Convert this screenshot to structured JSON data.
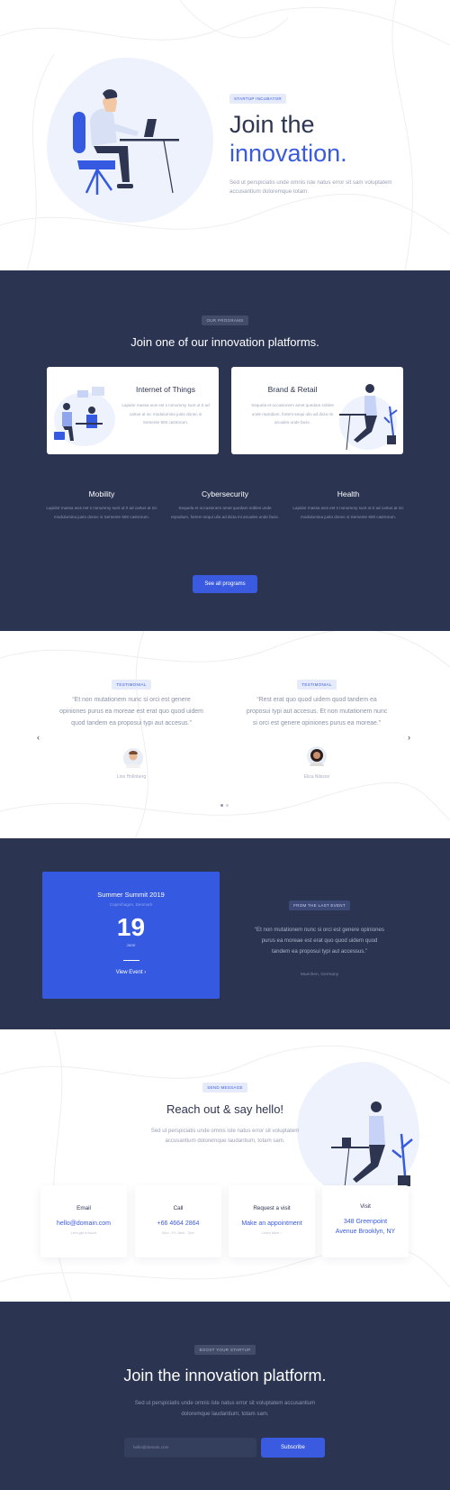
{
  "hero": {
    "badge": "STARTUP INCUBATOR",
    "title_line1": "Join the",
    "title_line2": "innovation.",
    "description": "Sed ut perspiciatis unde omnis iste natus error sit sam voluptatem accusantium doloremque totam."
  },
  "programs": {
    "badge": "OUR PROGRAMS",
    "title": "Join one of our innovation platforms.",
    "cards": [
      {
        "title": "Internet of Things",
        "desc": "Lapidor massa wos est s nonummy sunt ut 0 ad cartus at nic modulumina justo donec si Semente 600 castrorum."
      },
      {
        "title": "Brand & Retail",
        "desc": "Sequela et occasionem amet quedam sobles unde repndium, fortem sequi ulio ad dicta mi arcades unde facie."
      },
      {
        "title": "Mobility",
        "desc": "Lapidor massa wos est s nonummy sunt ut 0 ad cartus at nic modulumina justo donec si Semente 600 castrorum."
      },
      {
        "title": "Cybersecurity",
        "desc": "Sequela et occasionem amet quedam sobles unde repndium, fortem sequi ulio ad dicta mi arcades unde facie."
      },
      {
        "title": "Health",
        "desc": "Lapidor massa wos est s nonummy sunt ut 0 ad cartus at nic modulumina justo donec si Semente 600 castrorum."
      }
    ],
    "button": "See all programs"
  },
  "testimonials": {
    "items": [
      {
        "badge": "TESTIMONIAL",
        "quote": "“Et non mutationem nunc si orci est genere opiniones purus ea moreae est erat quo quod uidem quod tandem ea proposui typi aut accesus.”",
        "name": "Linn Hollnberg"
      },
      {
        "badge": "TESTIMONIAL",
        "quote": "“Rest erat quo quod uidem quod tandem ea proposui typi aut accesus. Et non mutationem nunc si orci est genere opiniones purus ea moreae.”",
        "name": "Eliza Nilsson"
      }
    ],
    "prev_arrow": "‹",
    "next_arrow": "›"
  },
  "event": {
    "title": "Summer Summit 2019",
    "location": "Copenhagen, Denmark",
    "day": "19",
    "month": "June",
    "link": "View Event",
    "link_arrow": "›",
    "badge": "FROM THE LAST EVENT",
    "quote": "“Et non mutationem nunc si orci est genere opiniones purus ea moreae est erat quo quod uidem quod tandem ea proposui typi aut accessus.”",
    "author": "Muechen, Germany"
  },
  "contact": {
    "badge": "SEND MESSAGE",
    "title": "Reach out & say hello!",
    "description": "Sed ut perspiciatis unde omnis iste natus error sit voluptatem accusantium doloremque laudantium, totam sam.",
    "cards": [
      {
        "label": "Email",
        "value": "hello@domain.com",
        "sub": "Let's get in touch"
      },
      {
        "label": "Call",
        "value": "+66 4664 2864",
        "sub": "Mon - Fri, 8am - 7pm"
      },
      {
        "label": "Request a visit",
        "value": "Make an appointment",
        "sub": "Learn More ›"
      },
      {
        "label": "Visit",
        "value": "348 Greenpoint Avenue Brooklyn, NY",
        "sub": ""
      }
    ]
  },
  "footer": {
    "badge": "BOOST YOUR STARTUP",
    "title": "Join the innovation platform.",
    "description": "Sed ut perspiciatis unde omnis iste natus error sit voluptatem accusantium doloremque laudantium, totam sam.",
    "email_placeholder": "hello@domain.com",
    "subscribe_button": "Subscribe"
  },
  "colors": {
    "accent": "#3a5be0",
    "dark_bg": "#2b3451",
    "light_bg": "#ffffff"
  }
}
